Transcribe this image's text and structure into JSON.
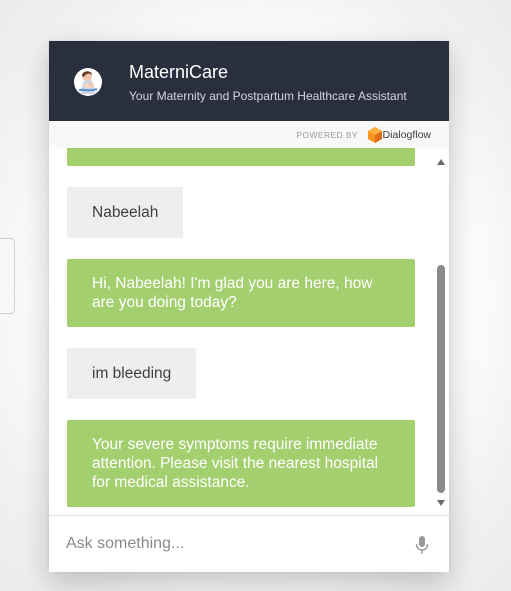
{
  "app": {
    "title": "MaterniCare",
    "subtitle": "Your Maternity and Postpartum Healthcare Assistant",
    "avatar_icon": "mother-baby-avatar"
  },
  "powered": {
    "label": "POWERED BY",
    "brand": "Dialogflow",
    "brand_icon": "dialogflow-logo-icon"
  },
  "messages": [
    {
      "from": "bot",
      "text": ""
    },
    {
      "from": "user",
      "text": "Nabeelah"
    },
    {
      "from": "bot",
      "text": "Hi, Nabeelah! I'm glad you are here, how are you doing today?"
    },
    {
      "from": "user",
      "text": "im bleeding"
    },
    {
      "from": "bot",
      "text": "Your severe symptoms require immediate attention. Please visit the nearest hospital for medical assistance."
    }
  ],
  "input": {
    "placeholder": "Ask something...",
    "value": "",
    "mic_icon": "microphone-icon"
  },
  "colors": {
    "header": "#2a2f3e",
    "bot_bubble": "#a3cf6f",
    "user_bubble": "#eeeeee",
    "dialogflow_orange": "#f7921e"
  }
}
